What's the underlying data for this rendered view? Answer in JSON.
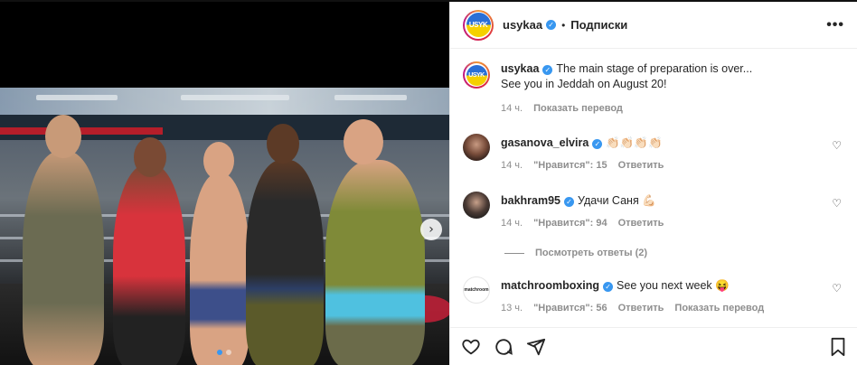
{
  "post": {
    "username": "usykaa",
    "separator": "•",
    "follow_label": "Подписки",
    "more_label": "•••",
    "avatar_text": "USYK",
    "caption": {
      "line1": "The main stage of preparation is over...",
      "line2": "See you in Jeddah on August 20!",
      "time": "14 ч.",
      "translate": "Показать перевод"
    }
  },
  "comments": [
    {
      "user": "gasanova_elvira",
      "text": "👏🏻👏🏻👏🏻👏🏻",
      "time": "14 ч.",
      "likes": "\"Нравится\": 15",
      "reply": "Ответить",
      "extra": ""
    },
    {
      "user": "bakhram95",
      "text": "Удачи Саня 💪🏻",
      "time": "14 ч.",
      "likes": "\"Нравится\": 94",
      "reply": "Ответить",
      "extra": ""
    },
    {
      "user": "matchroomboxing",
      "text": "See you next week 😝",
      "time": "13 ч.",
      "likes": "\"Нравится\": 56",
      "reply": "Ответить",
      "extra": "Показать перевод",
      "avatar_text": "matchroom"
    }
  ],
  "view_replies": "Посмотреть ответы (2)",
  "icons": {
    "verified": "verified-badge-icon",
    "like": "heart-icon",
    "comment": "comment-icon",
    "share": "share-icon",
    "save": "bookmark-icon",
    "next": "chevron-right-icon"
  },
  "colors": {
    "accent": "#3897f0",
    "text": "#262626",
    "muted": "#8e8e8e"
  },
  "carousel": {
    "current": 1,
    "total": 2
  }
}
